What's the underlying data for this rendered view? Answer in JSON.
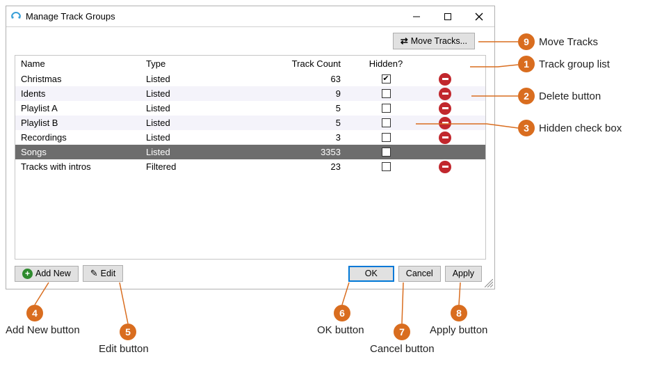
{
  "window": {
    "title": "Manage Track Groups"
  },
  "toolbar": {
    "move_tracks": "Move Tracks..."
  },
  "columns": {
    "name": "Name",
    "type": "Type",
    "count": "Track Count",
    "hidden": "Hidden?"
  },
  "rows": [
    {
      "name": "Christmas",
      "type": "Listed",
      "count": "63",
      "hidden": true,
      "selected": false,
      "deletable": true,
      "alt": false
    },
    {
      "name": "Idents",
      "type": "Listed",
      "count": "9",
      "hidden": false,
      "selected": false,
      "deletable": true,
      "alt": true
    },
    {
      "name": "Playlist A",
      "type": "Listed",
      "count": "5",
      "hidden": false,
      "selected": false,
      "deletable": true,
      "alt": false
    },
    {
      "name": "Playlist B",
      "type": "Listed",
      "count": "5",
      "hidden": false,
      "selected": false,
      "deletable": true,
      "alt": true
    },
    {
      "name": "Recordings",
      "type": "Listed",
      "count": "3",
      "hidden": false,
      "selected": false,
      "deletable": true,
      "alt": false
    },
    {
      "name": "Songs",
      "type": "Listed",
      "count": "3353",
      "hidden": false,
      "selected": true,
      "deletable": false,
      "alt": true
    },
    {
      "name": "Tracks with intros",
      "type": "Filtered",
      "count": "23",
      "hidden": false,
      "selected": false,
      "deletable": true,
      "alt": false
    }
  ],
  "buttons": {
    "add_new": "Add New",
    "edit": "Edit",
    "ok": "OK",
    "cancel": "Cancel",
    "apply": "Apply"
  },
  "annotations": {
    "1": "Track group list",
    "2": "Delete button",
    "3": "Hidden check box",
    "4": "Add New button",
    "5": "Edit button",
    "6": "OK button",
    "7": "Cancel button",
    "8": "Apply button",
    "9": "Move Tracks"
  }
}
